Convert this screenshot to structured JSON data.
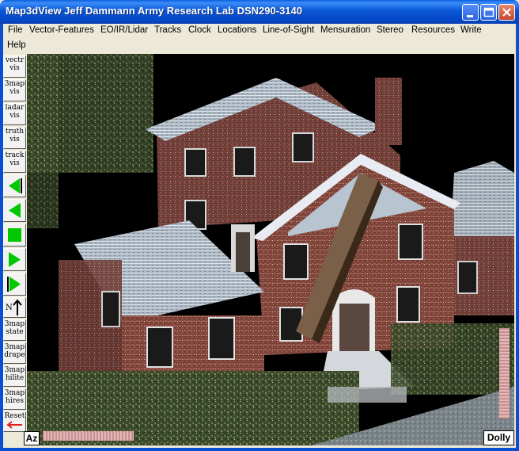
{
  "window": {
    "title": "Map3dView Jeff Dammann Army Research Lab DSN290-3140"
  },
  "menu": {
    "items": [
      "File",
      "Vector-Features",
      "EO/IR/Lidar",
      "Tracks",
      "Clock",
      "Locations",
      "Line-of-Sight",
      "Mensuration",
      "Stereo",
      "Resources",
      "Write",
      "Help"
    ]
  },
  "toolbar": {
    "vector": [
      "vectr",
      "vis"
    ],
    "map3": [
      "3map",
      "vis"
    ],
    "ladar": [
      "ladar",
      "vis"
    ],
    "truth": [
      "truth",
      "vis"
    ],
    "track": [
      "track",
      "vis"
    ],
    "north": "N",
    "map_state": [
      "3map",
      "state"
    ],
    "map_drape": [
      "3map",
      "drape"
    ],
    "map_hilite": [
      "3map",
      "hilite"
    ],
    "map_hires": [
      "3map",
      "hires"
    ],
    "reset": "Reset"
  },
  "controls": {
    "az_label": "Az",
    "dolly_label": "Dolly"
  },
  "colors": {
    "titlebar": "#0a57d6",
    "play_green": "#00c800",
    "reset_arrow": "#e02020",
    "slider": "#c98f8f"
  },
  "icons": [
    "minimize-icon",
    "maximize-icon",
    "close-icon",
    "step-back-end-icon",
    "play-back-icon",
    "stop-icon",
    "play-forward-icon",
    "step-forward-end-icon",
    "north-arrow-icon",
    "reset-arrow-icon"
  ]
}
